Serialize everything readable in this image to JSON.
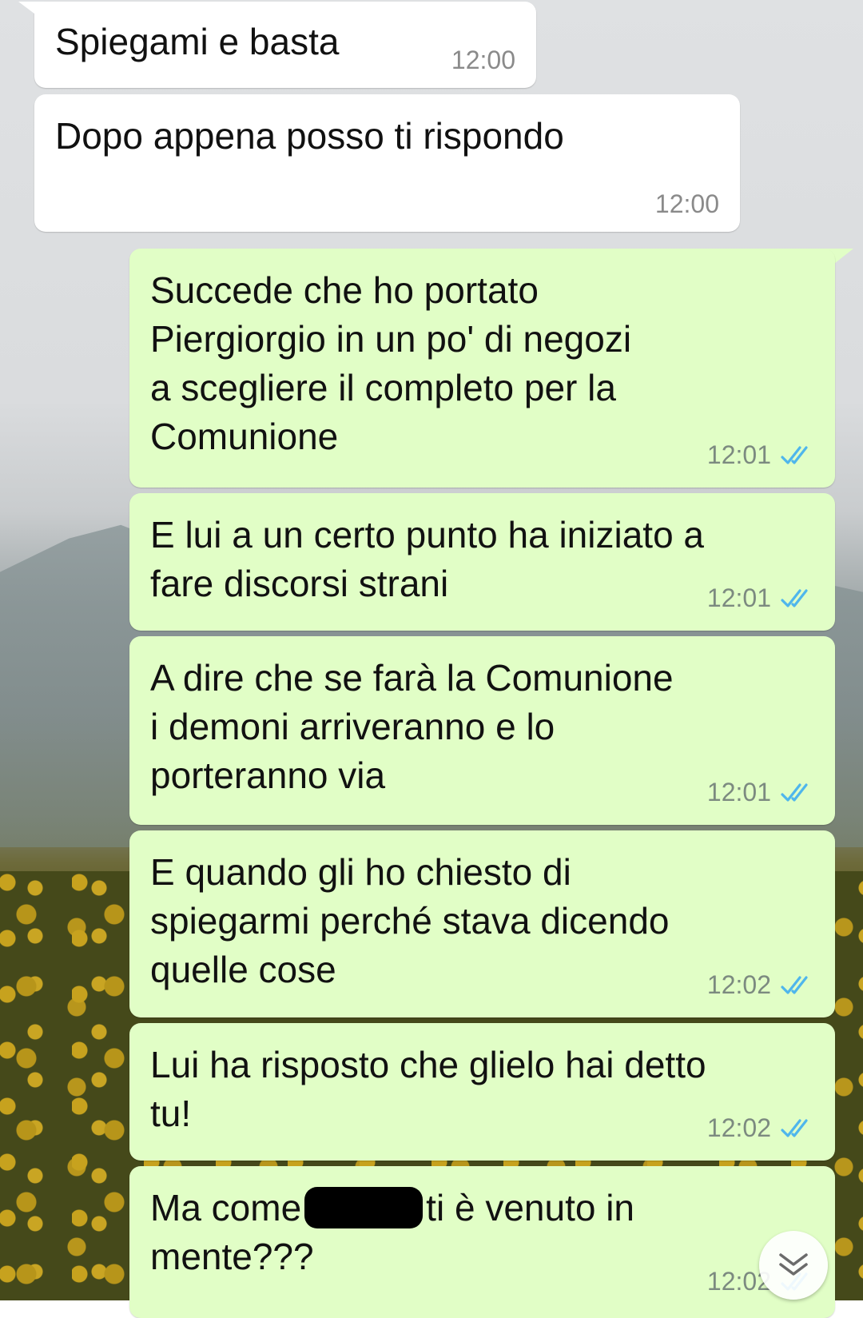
{
  "messages": [
    {
      "text": "Spiegami e basta",
      "time": "12:00",
      "direction": "incoming"
    },
    {
      "text": "Dopo appena posso ti rispondo",
      "time": "12:00",
      "direction": "incoming"
    },
    {
      "text": "Succede che ho portato\nPiergiorgio in un po' di negozi\na scegliere il completo per la\nComunione",
      "time": "12:01",
      "direction": "outgoing",
      "status": "read"
    },
    {
      "text": "E lui a un certo punto ha iniziato a\nfare discorsi strani",
      "time": "12:01",
      "direction": "outgoing",
      "status": "read"
    },
    {
      "text": "A dire che se farà la Comunione\ni demoni arriveranno e lo\nporteranno via",
      "time": "12:01",
      "direction": "outgoing",
      "status": "read"
    },
    {
      "text": "E quando gli ho chiesto di\nspiegarmi perché stava dicendo\nquelle cose",
      "time": "12:02",
      "direction": "outgoing",
      "status": "read"
    },
    {
      "text": "Lui ha risposto che glielo hai detto\ntu!",
      "time": "12:02",
      "direction": "outgoing",
      "status": "read"
    },
    {
      "text_before": "Ma come",
      "text_after": "ti è venuto in\nmente???",
      "time": "12:02",
      "direction": "outgoing",
      "status": "read",
      "redacted": true
    }
  ],
  "icons": {
    "read_receipt": "double-check-icon",
    "scroll_down": "chevron-double-down-icon"
  },
  "colors": {
    "incoming_bubble": "#ffffff",
    "outgoing_bubble": "#e1fec6",
    "read_tick": "#4fb6ec"
  }
}
